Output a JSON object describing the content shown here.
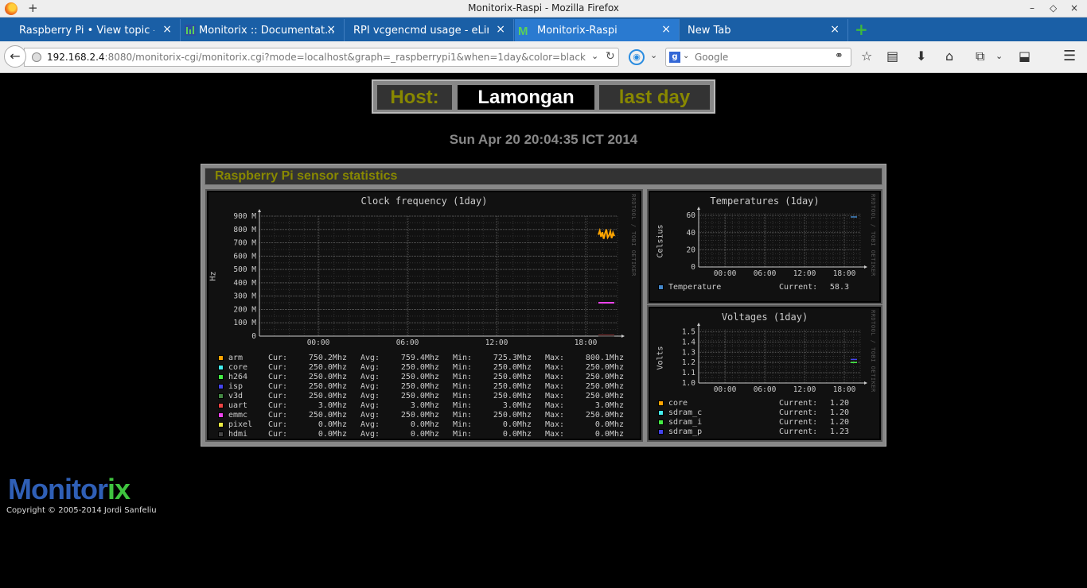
{
  "window": {
    "title": "Monitorix-Raspi - Mozilla Firefox",
    "new_window_symbol": "+",
    "controls": [
      "–",
      "◇",
      "×"
    ]
  },
  "tabs": [
    {
      "label": "Raspberry Pi • View topic - ...",
      "active": false
    },
    {
      "label": "Monitorix :: Documentat...",
      "active": false
    },
    {
      "label": "RPI vcgencmd usage - eLin...",
      "active": false
    },
    {
      "label": "Monitorix-Raspi",
      "active": true
    },
    {
      "label": "New Tab",
      "active": false
    }
  ],
  "tab_close_symbol": "×",
  "new_tab_symbol": "+",
  "navigation": {
    "back_symbol": "←",
    "url_host": "192.168.2.4",
    "url_rest": ":8080/monitorix-cgi/monitorix.cgi?mode=localhost&graph=_raspberrypi1&when=1day&color=black",
    "url_dropdown_symbol": "⌄",
    "reload_symbol": "↻",
    "search_engine_letter": "g",
    "search_placeholder": "Google",
    "toolbar_icons": [
      "star-icon",
      "reading-list-icon",
      "download-icon",
      "home-icon",
      "screenshot-icon",
      "downloads-addon-icon",
      "menu-icon"
    ]
  },
  "page": {
    "host_label": "Host:",
    "host_name": "Lamongan",
    "when_label": "last day",
    "datetime": "Sun Apr 20 20:04:35 ICT 2014",
    "panel_title": "Raspberry Pi sensor statistics",
    "logo_part1": "Monitor",
    "logo_part2": "ix",
    "copyright": "Copyright © 2005-2014 Jordi Sanfeliu"
  },
  "colors": {
    "accent_olive": "#888800",
    "arm": "#ffa500",
    "core": "#44eeee",
    "h264": "#44ee44",
    "isp": "#4444ee",
    "v3d": "#448844",
    "uart": "#ee4444",
    "emmc": "#ee44ee",
    "pixel": "#eeee44",
    "hdmi": "#444444",
    "temperature": "#4488cc",
    "sdram_c": "#44eeee",
    "sdram_i": "#44ee44",
    "sdram_p": "#4444ee"
  },
  "chart_data": [
    {
      "type": "line",
      "title": "Clock frequency  (1day)",
      "ylabel": "Hz",
      "watermark": "RRDTOOL / TOBI OETIKER",
      "x_ticks": [
        "00:00",
        "06:00",
        "12:00",
        "18:00"
      ],
      "y_ticks": [
        "0",
        "100 M",
        "200 M",
        "300 M",
        "400 M",
        "500 M",
        "600 M",
        "700 M",
        "800 M",
        "900 M"
      ],
      "ylim": [
        0,
        900
      ],
      "series": [
        {
          "name": "arm",
          "cur": "750.2Mhz",
          "avg": "759.4Mhz",
          "min": "725.3Mhz",
          "max": "800.1Mhz",
          "values": [
            760,
            790,
            745,
            780,
            730,
            770,
            800,
            740,
            755,
            785,
            735,
            775,
            750
          ]
        },
        {
          "name": "core",
          "cur": "250.0Mhz",
          "avg": "250.0Mhz",
          "min": "250.0Mhz",
          "max": "250.0Mhz",
          "values": [
            250,
            250
          ]
        },
        {
          "name": "h264",
          "cur": "250.0Mhz",
          "avg": "250.0Mhz",
          "min": "250.0Mhz",
          "max": "250.0Mhz",
          "values": [
            250,
            250
          ]
        },
        {
          "name": "isp",
          "cur": "250.0Mhz",
          "avg": "250.0Mhz",
          "min": "250.0Mhz",
          "max": "250.0Mhz",
          "values": [
            250,
            250
          ]
        },
        {
          "name": "v3d",
          "cur": "250.0Mhz",
          "avg": "250.0Mhz",
          "min": "250.0Mhz",
          "max": "250.0Mhz",
          "values": [
            250,
            250
          ]
        },
        {
          "name": "uart",
          "cur": "3.0Mhz",
          "avg": "3.0Mhz",
          "min": "3.0Mhz",
          "max": "3.0Mhz",
          "values": [
            3,
            3
          ]
        },
        {
          "name": "emmc",
          "cur": "250.0Mhz",
          "avg": "250.0Mhz",
          "min": "250.0Mhz",
          "max": "250.0Mhz",
          "values": [
            250,
            250
          ]
        },
        {
          "name": "pixel",
          "cur": "0.0Mhz",
          "avg": "0.0Mhz",
          "min": "0.0Mhz",
          "max": "0.0Mhz",
          "values": [
            0,
            0
          ]
        },
        {
          "name": "hdmi",
          "cur": "0.0Mhz",
          "avg": "0.0Mhz",
          "min": "0.0Mhz",
          "max": "0.0Mhz",
          "values": [
            0,
            0
          ]
        }
      ],
      "legend_labels": {
        "cur": "Cur:",
        "avg": "Avg:",
        "min": "Min:",
        "max": "Max:"
      }
    },
    {
      "type": "line",
      "title": "Temperatures  (1day)",
      "ylabel": "Celsius",
      "watermark": "RRDTOOL / TOBI OETIKER",
      "x_ticks": [
        "00:00",
        "06:00",
        "12:00",
        "18:00"
      ],
      "y_ticks": [
        "0",
        "20",
        "40",
        "60"
      ],
      "ylim": [
        0,
        62
      ],
      "series": [
        {
          "name": "Temperature",
          "current": "58.3",
          "values": [
            58.3,
            58.3
          ]
        }
      ],
      "current_label": "Current:"
    },
    {
      "type": "line",
      "title": "Voltages  (1day)",
      "ylabel": "Volts",
      "watermark": "RRDTOOL / TOBI OETIKER",
      "x_ticks": [
        "00:00",
        "06:00",
        "12:00",
        "18:00"
      ],
      "y_ticks": [
        "1.0",
        "1.1",
        "1.2",
        "1.3",
        "1.4",
        "1.5"
      ],
      "ylim": [
        1.0,
        1.52
      ],
      "series": [
        {
          "name": "core",
          "current": "1.20",
          "values": [
            1.2,
            1.2
          ]
        },
        {
          "name": "sdram_c",
          "current": "1.20",
          "values": [
            1.2,
            1.2
          ]
        },
        {
          "name": "sdram_i",
          "current": "1.20",
          "values": [
            1.2,
            1.2
          ]
        },
        {
          "name": "sdram_p",
          "current": "1.23",
          "values": [
            1.23,
            1.23
          ]
        }
      ],
      "current_label": "Current:"
    }
  ]
}
